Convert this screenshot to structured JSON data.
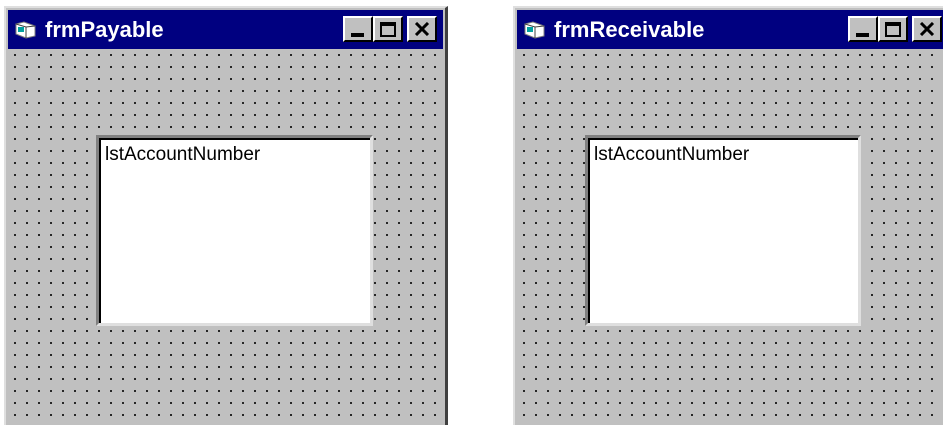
{
  "forms": [
    {
      "title": "frmPayable",
      "icon": "form-icon",
      "caption_buttons": [
        "minimize-icon",
        "maximize-icon",
        "close-icon"
      ],
      "listbox": {
        "name": "lstAccountNumber"
      }
    },
    {
      "title": "frmReceivable",
      "icon": "form-icon",
      "caption_buttons": [
        "minimize-icon",
        "maximize-icon",
        "close-icon"
      ],
      "listbox": {
        "name": "lstAccountNumber"
      }
    }
  ],
  "colors": {
    "title_bar": "#000080",
    "form_background": "#c0c0c0",
    "listbox_background": "#ffffff",
    "grid_dots": "#000000"
  }
}
